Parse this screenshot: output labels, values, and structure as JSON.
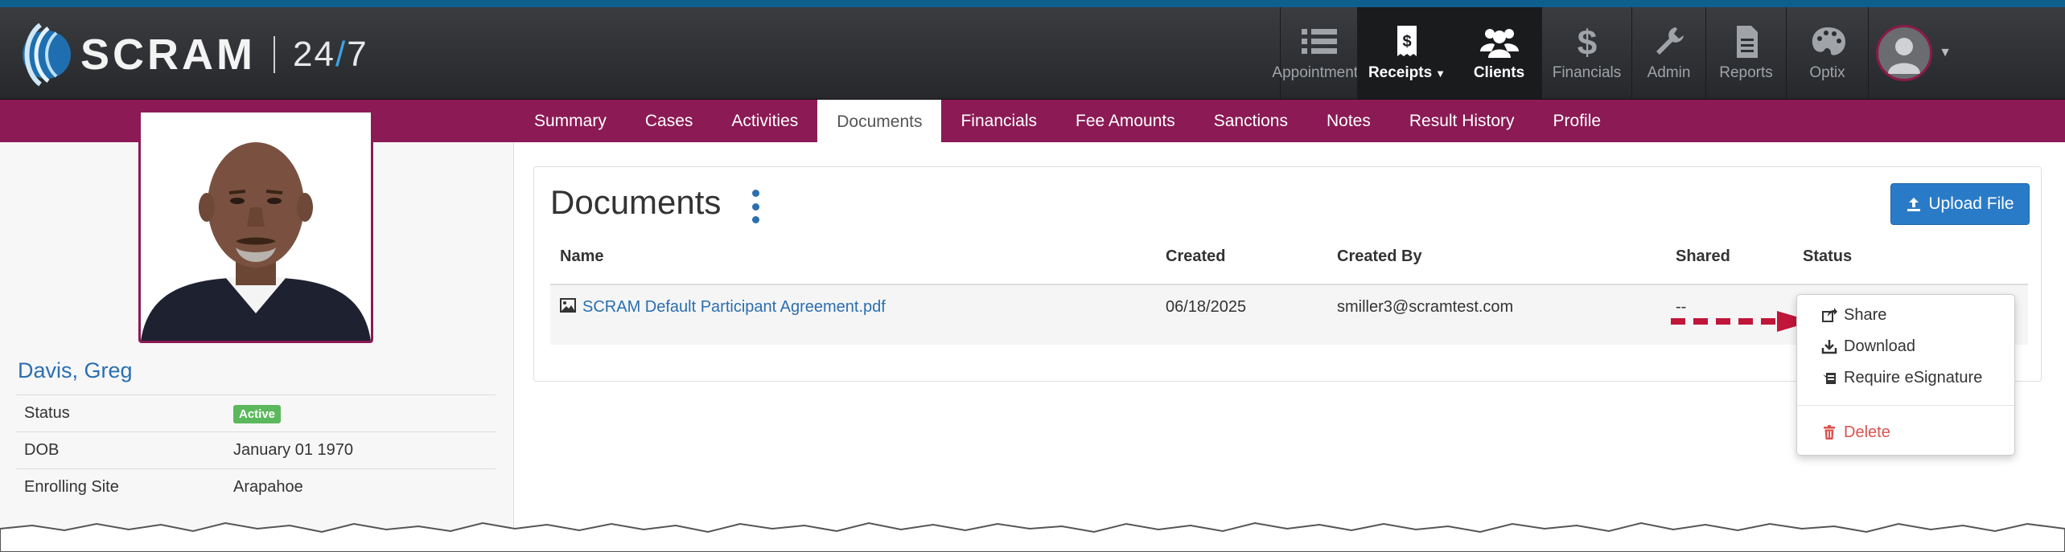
{
  "brand": {
    "name": "SCRAM",
    "suffix_a": "24",
    "suffix_slash": "/",
    "suffix_b": "7"
  },
  "nav": {
    "items": [
      {
        "label": "Appointments",
        "icon": "list-icon"
      },
      {
        "label": "Receipts",
        "icon": "receipt-dollar-icon"
      },
      {
        "label": "Clients",
        "icon": "users-icon"
      },
      {
        "label": "Financials",
        "icon": "dollar-icon"
      },
      {
        "label": "Admin",
        "icon": "wrench-icon"
      },
      {
        "label": "Reports",
        "icon": "document-icon"
      },
      {
        "label": "Optix",
        "icon": "palette-icon"
      }
    ]
  },
  "tabs": [
    "Summary",
    "Cases",
    "Activities",
    "Documents",
    "Financials",
    "Fee Amounts",
    "Sanctions",
    "Notes",
    "Result History",
    "Profile"
  ],
  "active_tab": "Documents",
  "client": {
    "name": "Davis, Greg",
    "fields": [
      {
        "label": "Status",
        "value": "Active"
      },
      {
        "label": "DOB",
        "value": "January 01 1970"
      },
      {
        "label": "Enrolling Site",
        "value": "Arapahoe"
      }
    ]
  },
  "documents": {
    "title": "Documents",
    "upload_label": "Upload File",
    "columns": [
      "Name",
      "Created",
      "Created By",
      "Shared",
      "Status"
    ],
    "rows": [
      {
        "name": "SCRAM Default Participant Agreement.pdf",
        "created": "06/18/2025",
        "created_by": "smiller3@scramtest.com",
        "shared": "--",
        "status": ""
      }
    ]
  },
  "menu": {
    "items": [
      {
        "label": "Share",
        "icon": "share-icon"
      },
      {
        "label": "Download",
        "icon": "download-icon"
      },
      {
        "label": "Require eSignature",
        "icon": "esignature-icon"
      },
      {
        "label": "Delete",
        "icon": "trash-icon"
      }
    ]
  },
  "colors": {
    "accent": "#8b1a55",
    "primary": "#2a7bc7",
    "success": "#5cb85c",
    "danger": "#d9534f",
    "arrow": "#c0163a"
  }
}
